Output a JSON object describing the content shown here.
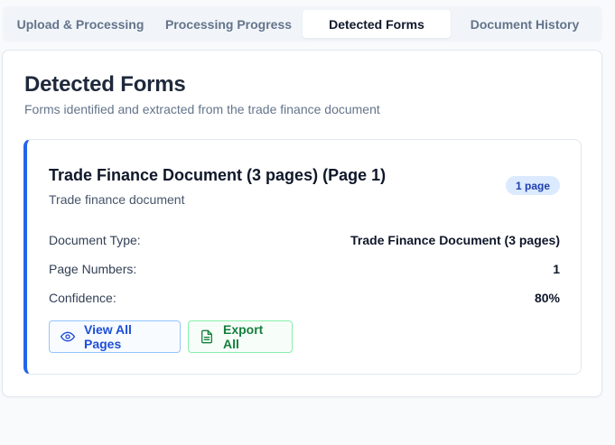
{
  "tabs": [
    {
      "label": "Upload & Processing",
      "active": false
    },
    {
      "label": "Processing Progress",
      "active": false
    },
    {
      "label": "Detected Forms",
      "active": true
    },
    {
      "label": "Document History",
      "active": false
    }
  ],
  "panel": {
    "title": "Detected Forms",
    "subtitle": "Forms identified and extracted from the trade finance document"
  },
  "form": {
    "title": "Trade Finance Document (3 pages) (Page 1)",
    "description": "Trade finance document",
    "badge": "1 page",
    "fields": [
      {
        "label": "Document Type:",
        "value": "Trade Finance Document (3 pages)"
      },
      {
        "label": "Page Numbers:",
        "value": "1"
      },
      {
        "label": "Confidence:",
        "value": "80%"
      }
    ],
    "actions": {
      "view_label": "View All Pages",
      "export_label": "Export All"
    }
  },
  "icons": {
    "view": "eye-icon",
    "export": "document-icon"
  },
  "colors": {
    "accent": "#2563eb",
    "view_button": "#1d4ed8",
    "export_button": "#15803d",
    "badge_bg": "#dbeafe"
  }
}
